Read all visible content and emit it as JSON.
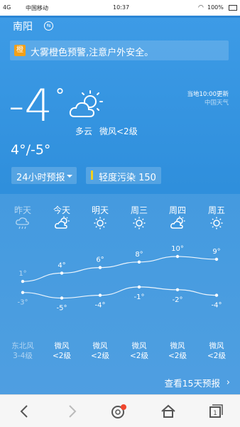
{
  "status_bar": {
    "signal": "4G",
    "carrier": "中国移动",
    "time": "10:37",
    "battery": "100%"
  },
  "location": {
    "city": "南阳"
  },
  "alert": {
    "icon_text": "橙",
    "text": "大雾橙色预警,注意户外安全。",
    "color": "#f2a019"
  },
  "current": {
    "temperature": "-4",
    "degree_symbol": "°",
    "condition": "多云",
    "wind": "微风<2级",
    "updated": "当地10:00更新",
    "source": "中国天气",
    "range": "4°/-5°",
    "icon": "partly-cloudy-icon"
  },
  "forecast_button": {
    "label": "24小时预报"
  },
  "air_quality": {
    "label": "轻度污染 150",
    "color": "#f4d01b"
  },
  "days": [
    {
      "name": "昨天",
      "icon": "rain-icon",
      "high": "1°",
      "low": "-3°",
      "wind_dir": "东北风",
      "wind_level": "3-4级",
      "past": true
    },
    {
      "name": "今天",
      "icon": "partly-cloudy-icon",
      "high": "4°",
      "low": "-5°",
      "wind_dir": "微风",
      "wind_level": "<2级",
      "past": false
    },
    {
      "name": "明天",
      "icon": "sun-icon",
      "high": "6°",
      "low": "-4°",
      "wind_dir": "微风",
      "wind_level": "<2级",
      "past": false
    },
    {
      "name": "周三",
      "icon": "sun-icon",
      "high": "8°",
      "low": "-1°",
      "wind_dir": "微风",
      "wind_level": "<2级",
      "past": false
    },
    {
      "name": "周四",
      "icon": "partly-cloudy-icon",
      "high": "10°",
      "low": "-2°",
      "wind_dir": "微风",
      "wind_level": "<2级",
      "past": false
    },
    {
      "name": "周五",
      "icon": "sun-icon",
      "high": "9°",
      "low": "-4°",
      "wind_dir": "微风",
      "wind_level": "<2级",
      "past": false
    }
  ],
  "chart_data": {
    "type": "line",
    "categories": [
      "昨天",
      "今天",
      "明天",
      "周三",
      "周四",
      "周五"
    ],
    "series": [
      {
        "values": [
          1,
          4,
          6,
          8,
          10,
          9
        ]
      },
      {
        "values": [
          -3,
          -5,
          -4,
          -1,
          -2,
          -4
        ]
      }
    ]
  },
  "more_link": {
    "label": "查看15天预报",
    "arrow": "›"
  },
  "navbar": {
    "items": [
      "back-icon",
      "forward-icon",
      "browser-icon",
      "home-icon",
      "tabs-icon"
    ],
    "tab_count": "1"
  }
}
